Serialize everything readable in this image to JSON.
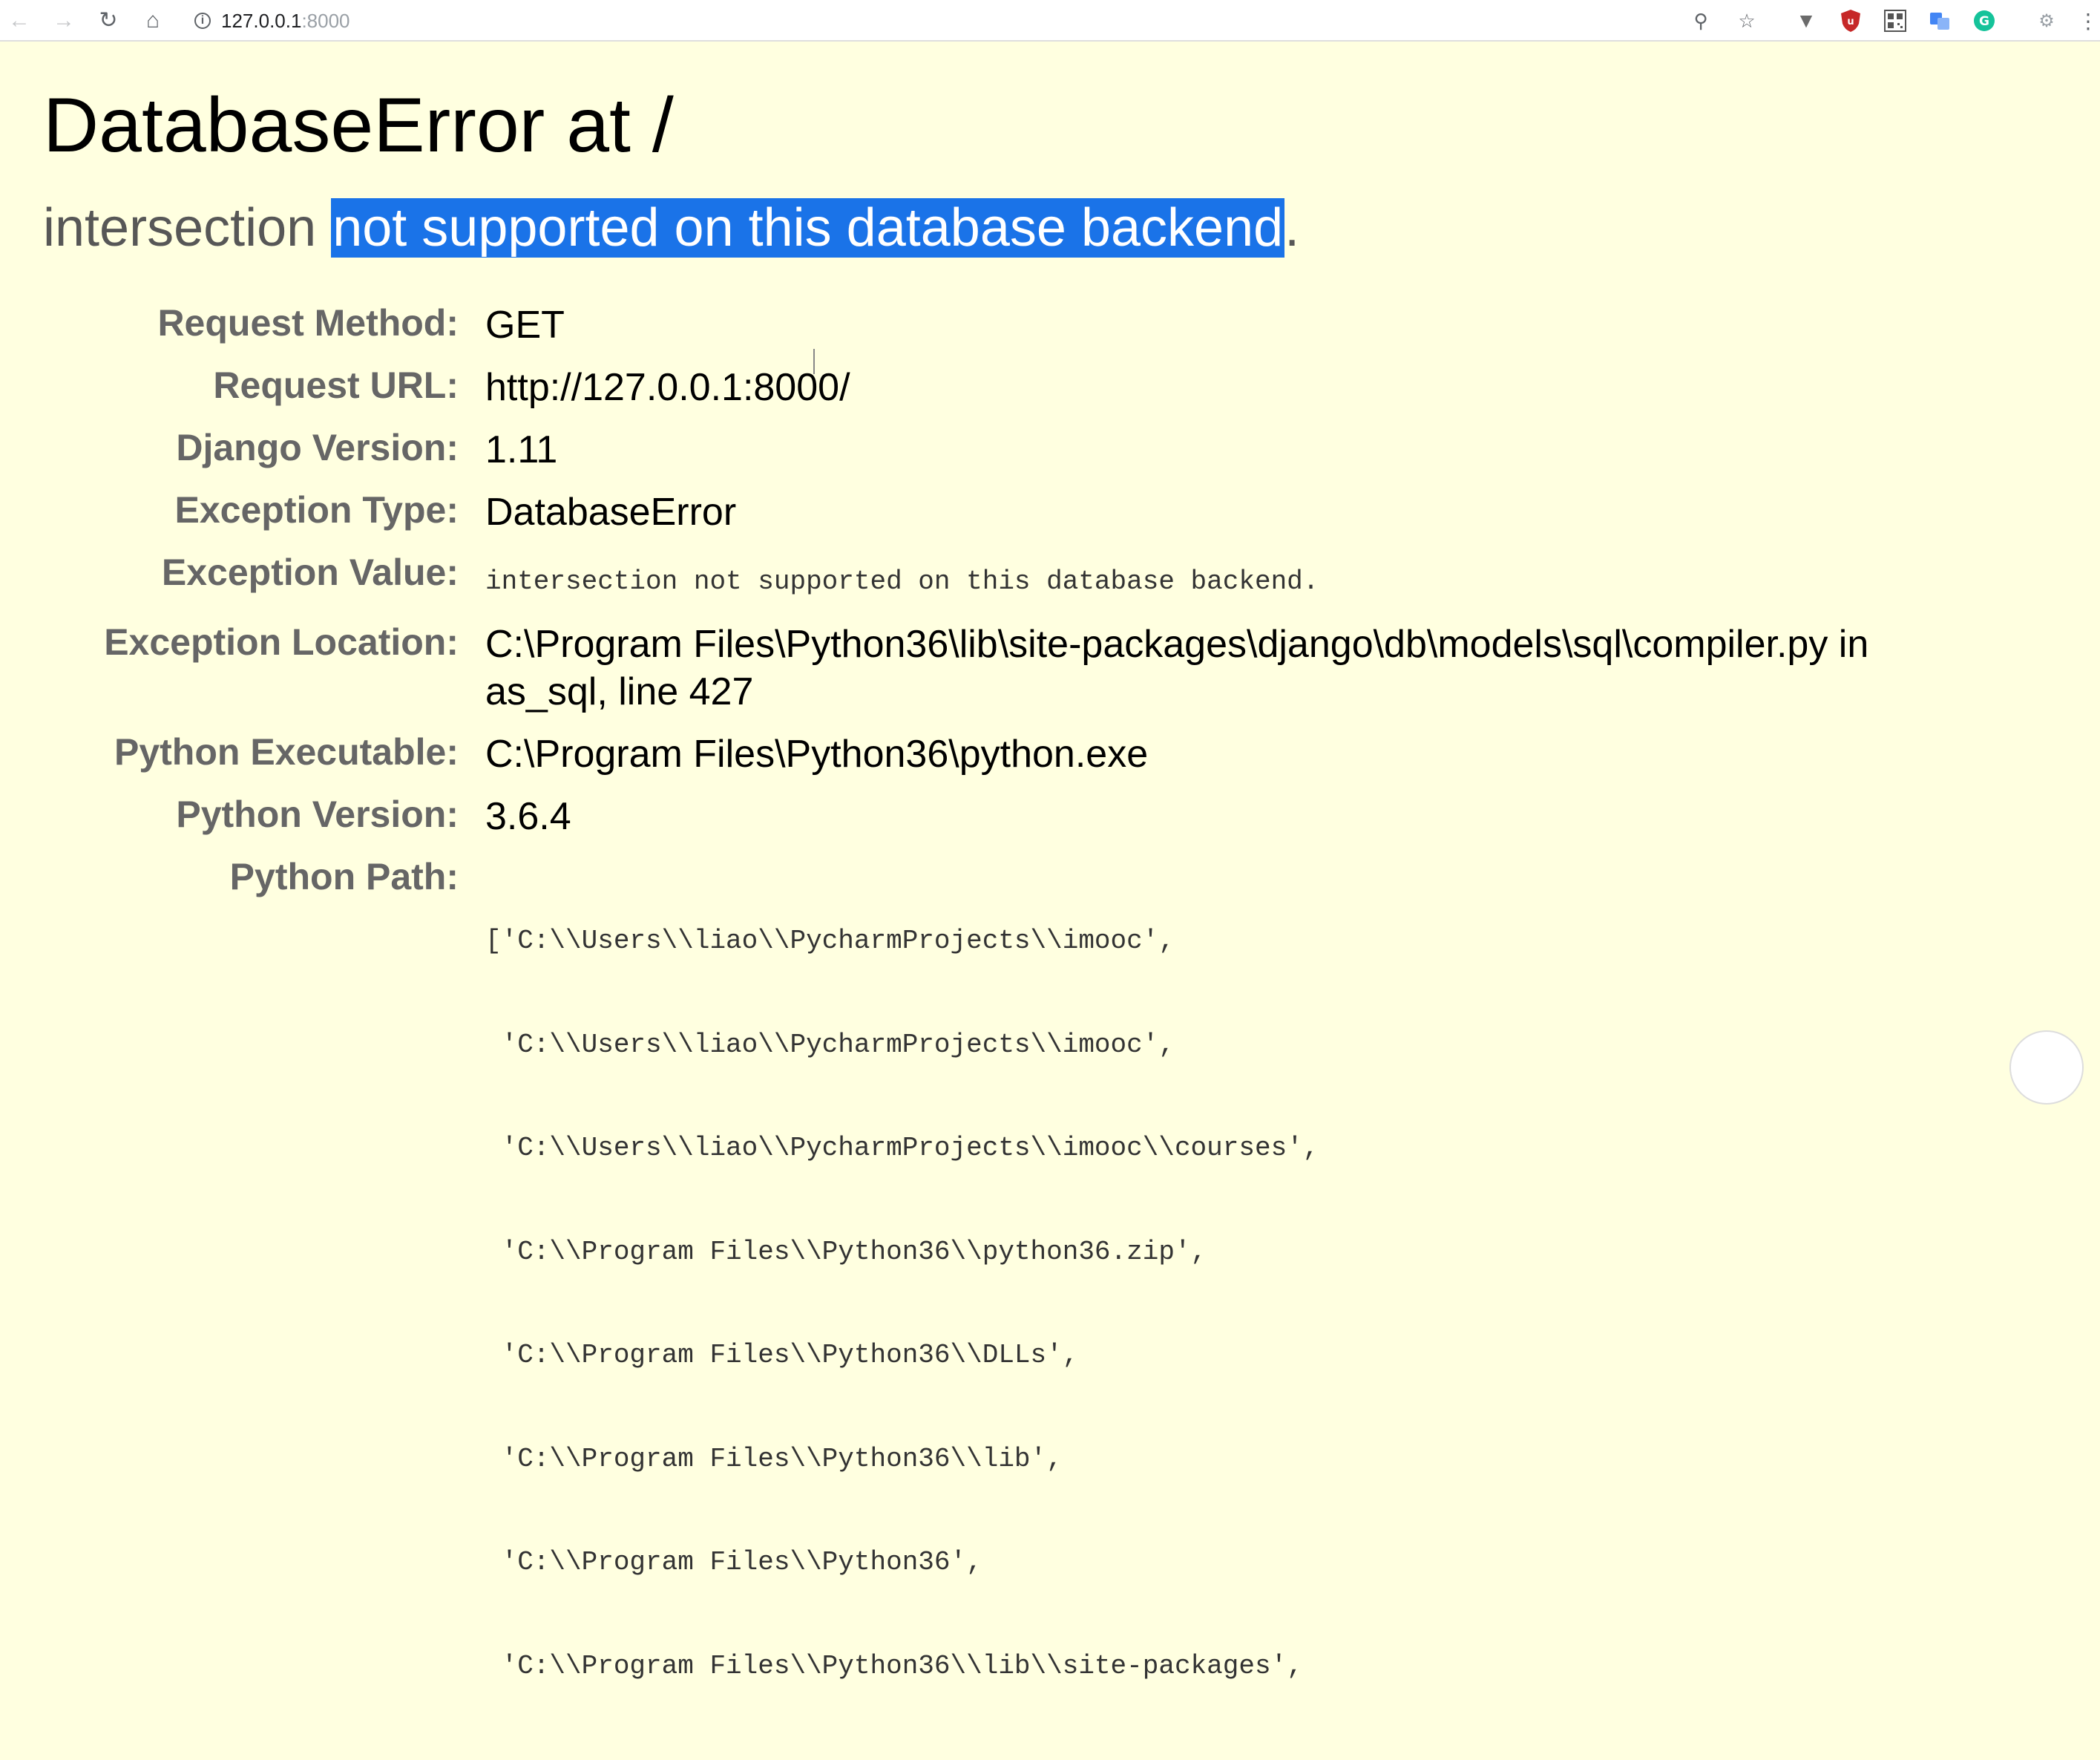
{
  "browser": {
    "url_host": "127.0.0.1",
    "url_port": ":8000",
    "icons": [
      "back-icon",
      "forward-icon",
      "reload-icon",
      "home-icon",
      "info-icon",
      "zoom-icon",
      "star-icon",
      "vpn-icon",
      "ublock-icon",
      "qr-icon",
      "translate-icon",
      "grammarly-icon",
      "extension-icon",
      "menu-icon"
    ]
  },
  "error": {
    "title": "DatabaseError at /",
    "summary_prefix": "intersection ",
    "summary_highlight": "not supported on this database backend",
    "summary_suffix": "."
  },
  "meta": {
    "request_method_label": "Request Method:",
    "request_method": "GET",
    "request_url_label": "Request URL:",
    "request_url": "http://127.0.0.1:8000/",
    "django_version_label": "Django Version:",
    "django_version": "1.11",
    "exception_type_label": "Exception Type:",
    "exception_type": "DatabaseError",
    "exception_value_label": "Exception Value:",
    "exception_value": "intersection not supported on this database backend.",
    "exception_location_label": "Exception Location:",
    "exception_location": "C:\\Program Files\\Python36\\lib\\site-packages\\django\\db\\models\\sql\\compiler.py in as_sql, line 427",
    "python_executable_label": "Python Executable:",
    "python_executable": "C:\\Program Files\\Python36\\python.exe",
    "python_version_label": "Python Version:",
    "python_version": "3.6.4",
    "python_path_label": "Python Path:",
    "python_path": [
      "['C:\\\\Users\\\\liao\\\\PycharmProjects\\\\imooc',",
      " 'C:\\\\Users\\\\liao\\\\PycharmProjects\\\\imooc',",
      " 'C:\\\\Users\\\\liao\\\\PycharmProjects\\\\imooc\\\\courses',",
      " 'C:\\\\Program Files\\\\Python36\\\\python36.zip',",
      " 'C:\\\\Program Files\\\\Python36\\\\DLLs',",
      " 'C:\\\\Program Files\\\\Python36\\\\lib',",
      " 'C:\\\\Program Files\\\\Python36',",
      " 'C:\\\\Program Files\\\\Python36\\\\lib\\\\site-packages',"
    ]
  }
}
